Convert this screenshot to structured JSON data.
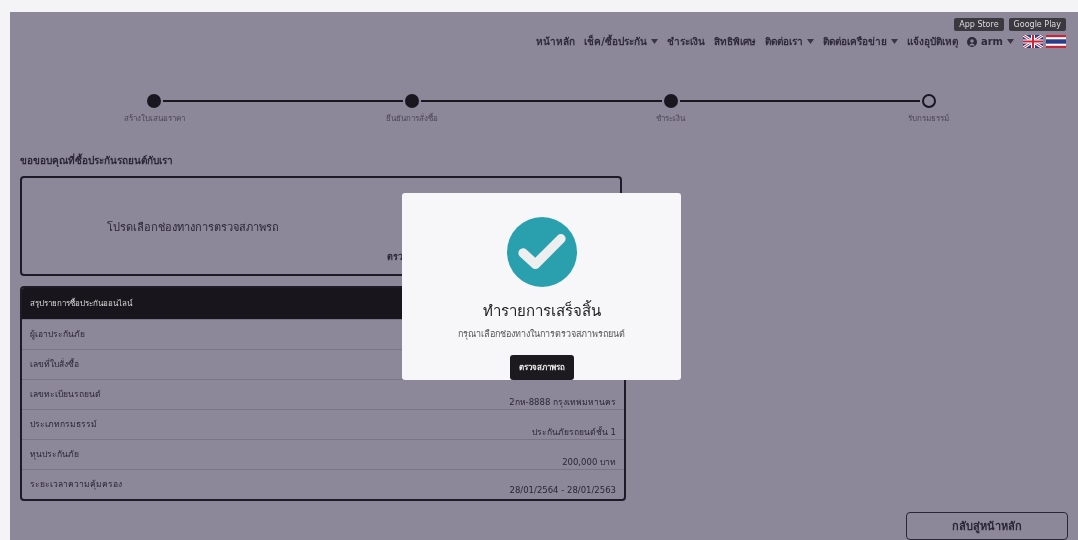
{
  "nav": {
    "store_badges": [
      "App Store",
      "Google Play"
    ],
    "items": [
      {
        "label": "หน้าหลัก",
        "dropdown": false
      },
      {
        "label": "เช็ค/ซื้อประกัน",
        "dropdown": true
      },
      {
        "label": "ชำระเงิน",
        "dropdown": false
      },
      {
        "label": "สิทธิพิเศษ",
        "dropdown": false
      },
      {
        "label": "ติดต่อเรา",
        "dropdown": true
      },
      {
        "label": "ติดต่อเครือข่าย",
        "dropdown": true
      },
      {
        "label": "แจ้งอุบัติเหตุ",
        "dropdown": false
      }
    ],
    "user": {
      "name": "arm",
      "dropdown": true
    }
  },
  "steps": [
    {
      "label": "สร้างใบเสนอราคา",
      "done": true
    },
    {
      "label": "ยืนยันการสั่งซื้อ",
      "done": true
    },
    {
      "label": "ชำระเงิน",
      "done": true
    },
    {
      "label": "รับกรมธรรม์",
      "done": false
    }
  ],
  "heading": "ขอขอบคุณที่ซื้อประกันรถยนต์กับเรา",
  "inspection_card": {
    "text": "โปรดเลือกช่องทางการตรวจสภาพรถ",
    "button": "ตรว"
  },
  "summary": {
    "title": "สรุปรายการซื้อประกันออนไลน์",
    "rows": [
      {
        "label": "ผู้เอาประกันภัย"
      },
      {
        "label": "เลขที่ใบสั่งซื้อ"
      },
      {
        "label": "เลขทะเบียนรถยนต์",
        "value": "2กห-8888 กรุงเทพมหานคร"
      },
      {
        "label": "ประเภทกรมธรรม์",
        "value": "ประกันภัยรถยนต์ชั้น 1"
      },
      {
        "label": "ทุนประกันภัย",
        "value": "200,000 บาท"
      },
      {
        "label": "ระยะเวลาความคุ้มครอง",
        "value": "28/01/2564 - 28/01/2563"
      }
    ]
  },
  "back_button": "กลับสู่หน้าหลัก",
  "modal": {
    "title": "ทำรายการเสร็จสิ้น",
    "message": "กรุณาเลือกช่องทางในการตรวจสภาพรถยนต์",
    "button": "ตรวจสภาพรถ"
  }
}
